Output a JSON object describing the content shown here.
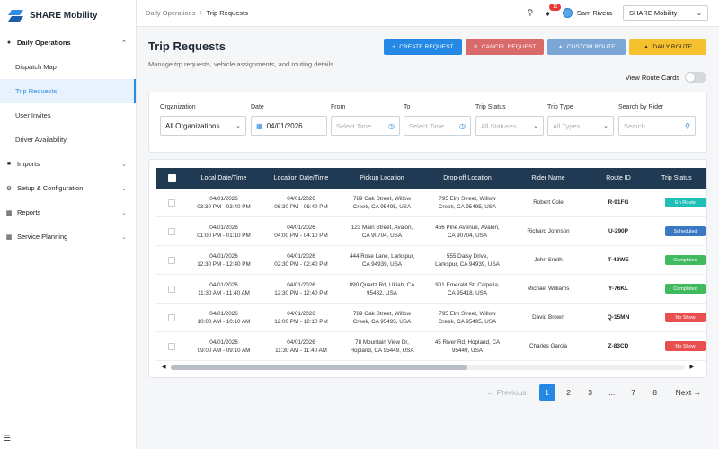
{
  "app": {
    "name": "SHARE Mobility"
  },
  "sidebar": {
    "sections": [
      {
        "label": "Daily Operations",
        "icon": "location-pin-icon",
        "expanded": true,
        "items": [
          "Dispatch Map",
          "Trip Requests",
          "User Invites",
          "Driver Availability"
        ],
        "active_item": "Trip Requests"
      },
      {
        "label": "Imports",
        "icon": "import-icon"
      },
      {
        "label": "Setup & Configuration",
        "icon": "settings-icon"
      },
      {
        "label": "Reports",
        "icon": "chart-icon"
      },
      {
        "label": "Service Planning",
        "icon": "map-icon"
      }
    ],
    "footer_icon": "menu-icon"
  },
  "topbar": {
    "breadcrumb": {
      "parent": "Daily Operations",
      "separator": "/",
      "current": "Trip Requests"
    },
    "notifications_count": "11",
    "user_name": "Sam Rivera",
    "org_select": "SHARE Mobility"
  },
  "page": {
    "title": "Trip Requests",
    "subtitle": "Manage trp requests, vehicle assignments, and routing details.",
    "buttons": {
      "create": "CREATE REQUEST",
      "cancel": "CANCEL REQUEST",
      "custom": "CUSTOM ROUTE",
      "daily": "DAILY ROUTE"
    },
    "view_route_cards": {
      "label": "View Route Cards",
      "on": false
    }
  },
  "filters": {
    "organization": {
      "label": "Organization",
      "value": "All Organizations"
    },
    "date": {
      "label": "Date",
      "value": "04/01/2026"
    },
    "from": {
      "label": "From",
      "placeholder": "Select Time"
    },
    "to": {
      "label": "To",
      "placeholder": "Select Time"
    },
    "trip_status": {
      "label": "Trip Status",
      "placeholder": "All Statuses"
    },
    "trip_type": {
      "label": "Trip Type",
      "placeholder": "All Types"
    },
    "search": {
      "label": "Search by Rider",
      "placeholder": "Search..."
    }
  },
  "table": {
    "columns": [
      "Local Date/Time",
      "Location Date/Time",
      "Pickup Location",
      "Drop-off Location",
      "Rider Name",
      "Route ID",
      "Trip Status"
    ],
    "rows": [
      {
        "local_date": "04/01/2026",
        "local_time": "03:30 PM - 03:40 PM",
        "loc_date": "04/01/2026",
        "loc_time": "06:30 PM - 06:40 PM",
        "pickup1": "789 Oak Street, Willow",
        "pickup2": "Creek, CA 95495, USA",
        "drop1": "795 Elm Street, Willow",
        "drop2": "Creek, CA 95495, USA",
        "rider": "Robert Cole",
        "route": "R-91FG",
        "status": "En Route"
      },
      {
        "local_date": "04/01/2026",
        "local_time": "01:00 PM - 01:10 PM",
        "loc_date": "04/01/2026",
        "loc_time": "04:00 PM - 04:10 PM",
        "pickup1": "123 Main Street, Avalon,",
        "pickup2": "CA 90704, USA",
        "drop1": "456 Pine Avenue, Avalon,",
        "drop2": "CA 90704, USA",
        "rider": "Richard Johnson",
        "route": "U-290P",
        "status": "Scheduled"
      },
      {
        "local_date": "04/01/2026",
        "local_time": "12:30 PM - 12:40 PM",
        "loc_date": "04/01/2026",
        "loc_time": "02:30 PM - 02:40 PM",
        "pickup1": "444 Rose Lane, Larkspur,",
        "pickup2": "CA 94939, USA",
        "drop1": "555 Daisy Drive,",
        "drop2": "Larkspur, CA 94939, USA",
        "rider": "John Smith",
        "route": "T-42WE",
        "status": "Completed"
      },
      {
        "local_date": "04/01/2026",
        "local_time": "11:30 AM - 11:40 AM",
        "loc_date": "04/01/2026",
        "loc_time": "12:30 PM - 12:40 PM",
        "pickup1": "890 Quartz Rd, Ukiah, CA",
        "pickup2": "95482, USA",
        "drop1": "901 Emerald St, Calpella,",
        "drop2": "CA 95418, USA",
        "rider": "Michael Williams",
        "route": "Y-76KL",
        "status": "Completed"
      },
      {
        "local_date": "04/01/2026",
        "local_time": "10:00 AM - 10:10 AM",
        "loc_date": "04/01/2026",
        "loc_time": "12:00 PM - 12:10 PM",
        "pickup1": "789 Oak Street, Willow",
        "pickup2": "Creek, CA 95495, USA",
        "drop1": "795 Elm Street, Willow",
        "drop2": "Creek, CA 95495, USA",
        "rider": "David Brown",
        "route": "Q-15MN",
        "status": "No Show"
      },
      {
        "local_date": "04/01/2026",
        "local_time": "09:00 AM - 09:10 AM",
        "loc_date": "04/01/2026",
        "loc_time": "11:30 AM - 11:40 AM",
        "pickup1": "78 Mountain View Dr,",
        "pickup2": "Hopland, CA 95449, USA",
        "drop1": "45 River Rd, Hopland, CA",
        "drop2": "95449, USA",
        "rider": "Charles Garcia",
        "route": "Z-83CD",
        "status": "No Show"
      }
    ]
  },
  "status_colors": {
    "En Route": "#1fbfb8",
    "Scheduled": "#3a78c4",
    "Completed": "#3fba5e",
    "No Show": "#e8504f"
  },
  "pagination": {
    "prev": "← Previous",
    "pages": [
      "1",
      "2",
      "3",
      "...",
      "7",
      "8"
    ],
    "current": "1",
    "next": "Next →"
  }
}
